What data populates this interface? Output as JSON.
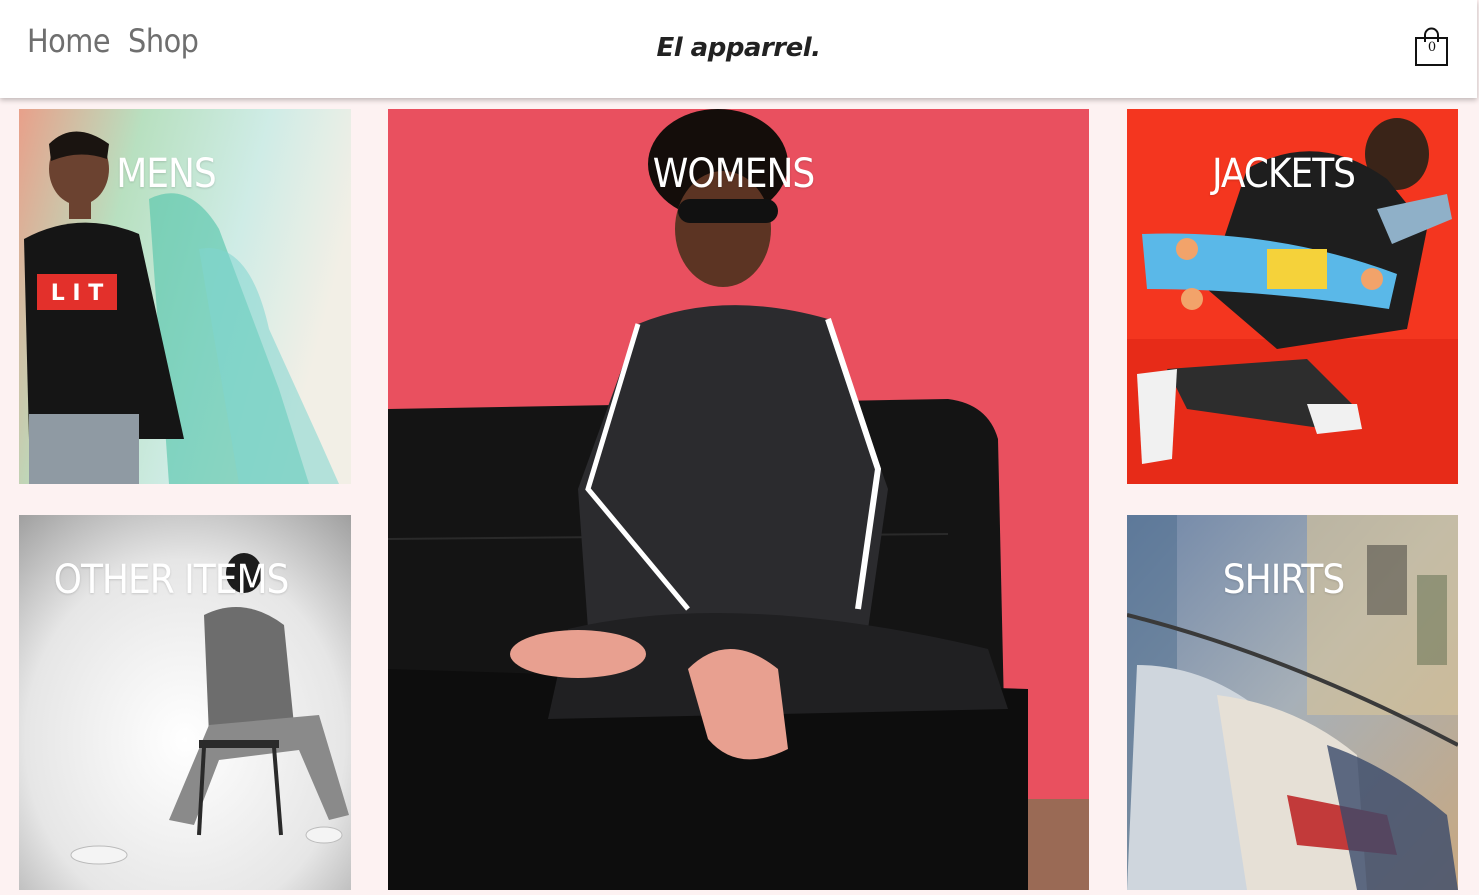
{
  "nav": {
    "home": "Home",
    "shop": "Shop"
  },
  "brand": "El apparrel.",
  "cart": {
    "count": "0",
    "icon": "shopping-bag-icon"
  },
  "tiles": {
    "mens": {
      "label": "MENS"
    },
    "womens": {
      "label": "WOMENS"
    },
    "jackets": {
      "label": "JACKETS"
    },
    "other": {
      "label": "OTHER ITEMS"
    },
    "shirts": {
      "label": "SHIRTS"
    }
  },
  "colors": {
    "page_bg": "#fdf2f2",
    "nav_text": "#6f6f6f",
    "label_text": "#ffffff"
  }
}
